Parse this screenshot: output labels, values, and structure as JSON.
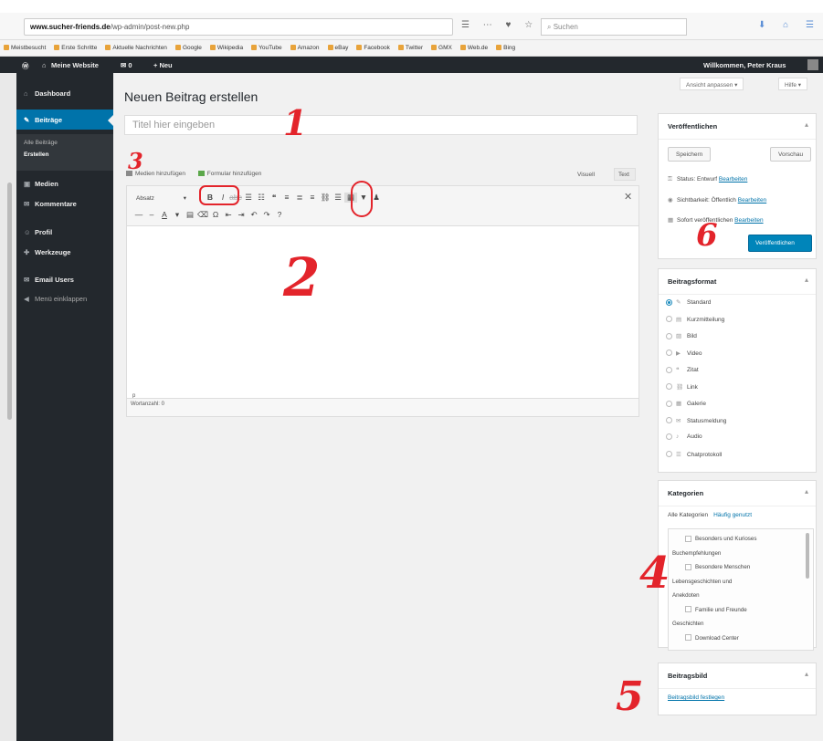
{
  "browser": {
    "url_domain": "www.sucher-friends.de",
    "url_path": "/wp-admin/post-new.php",
    "search_placeholder": "Suchen",
    "bookmarks": [
      "Meistbesucht",
      "Erste Schritte",
      "Aktuelle Nachrichten",
      "Google",
      "Wikipedia",
      "YouTube",
      "Amazon",
      "eBay",
      "Facebook",
      "Twitter",
      "GMX",
      "Web.de",
      "Bing"
    ]
  },
  "adminbar": {
    "site_name": "Meine Website",
    "new_label": "+ Neu",
    "greeting": "Willkommen, Peter Kraus"
  },
  "sidebar": {
    "items": [
      {
        "label": "Dashboard",
        "icon": "dashboard-icon",
        "glyph": "⌂"
      },
      {
        "label": "Beiträge",
        "icon": "pin-icon",
        "glyph": "✎"
      },
      {
        "label": "Medien",
        "icon": "media-icon",
        "glyph": "▣"
      },
      {
        "label": "Kommentare",
        "icon": "comment-icon",
        "glyph": "✉"
      },
      {
        "label": "Profil",
        "icon": "user-icon",
        "glyph": "☺"
      },
      {
        "label": "Werkzeuge",
        "icon": "wrench-icon",
        "glyph": "✚"
      },
      {
        "label": "Email Users",
        "icon": "email-icon",
        "glyph": "✉"
      },
      {
        "label": "Menü einklappen",
        "icon": "collapse-icon",
        "glyph": "◀"
      }
    ],
    "sub_all": "Alle Beiträge",
    "sub_new": "Erstellen"
  },
  "header": {
    "screen_options": "Ansicht anpassen ▾",
    "help": "Hilfe ▾",
    "page_title": "Neuen Beitrag erstellen"
  },
  "editor": {
    "title_placeholder": "Titel hier eingeben",
    "add_media": "Medien hinzufügen",
    "add_form": "Formular hinzufügen",
    "tab_visual": "Visuell",
    "tab_text": "Text",
    "format_select": "Absatz",
    "path": "p",
    "word_count": "Wortanzahl: 0"
  },
  "publish": {
    "title": "Veröffentlichen",
    "save_draft": "Speichern",
    "preview": "Vorschau",
    "status_label": "Status: Entwurf",
    "visibility_label": "Sichtbarkeit: Öffentlich",
    "schedule_label": "Sofort veröffentlichen",
    "edit_link": "Bearbeiten",
    "publish_button": "Veröffentlichen"
  },
  "formats": {
    "title": "Beitragsformat",
    "items": [
      {
        "label": "Standard",
        "glyph": "✎",
        "checked": true
      },
      {
        "label": "Kurzmitteilung",
        "glyph": "▤",
        "checked": false
      },
      {
        "label": "Bild",
        "glyph": "▨",
        "checked": false
      },
      {
        "label": "Video",
        "glyph": "▶",
        "checked": false
      },
      {
        "label": "Zitat",
        "glyph": "❝",
        "checked": false
      },
      {
        "label": "Link",
        "glyph": "⛓",
        "checked": false
      },
      {
        "label": "Galerie",
        "glyph": "▦",
        "checked": false
      },
      {
        "label": "Statusmeldung",
        "glyph": "✉",
        "checked": false
      },
      {
        "label": "Audio",
        "glyph": "♪",
        "checked": false
      },
      {
        "label": "Chatprotokoll",
        "glyph": "☰",
        "checked": false
      }
    ]
  },
  "categories": {
    "title": "Kategorien",
    "tab_all": "Alle Kategorien",
    "tab_popular": "Häufig genutzt",
    "items": [
      "Besonders und Kurioses",
      "Buchempfehlungen",
      "Besondere Menschen",
      "Lebensgeschichten und",
      "Anekdoten",
      "Familie und Freunde",
      "Geschichten",
      "Download Center"
    ]
  },
  "thumbnail": {
    "title": "Beitragsbild",
    "link": "Beitragsbild festlegen"
  },
  "annotations": {
    "n1": "1",
    "n2": "2",
    "n3": "3",
    "n4": "4",
    "n5": "5",
    "n6": "6"
  },
  "colors": {
    "accent": "#0073aa",
    "primary_button": "#0085ba",
    "admin_dark": "#23282d",
    "annotation": "#e3242b"
  }
}
